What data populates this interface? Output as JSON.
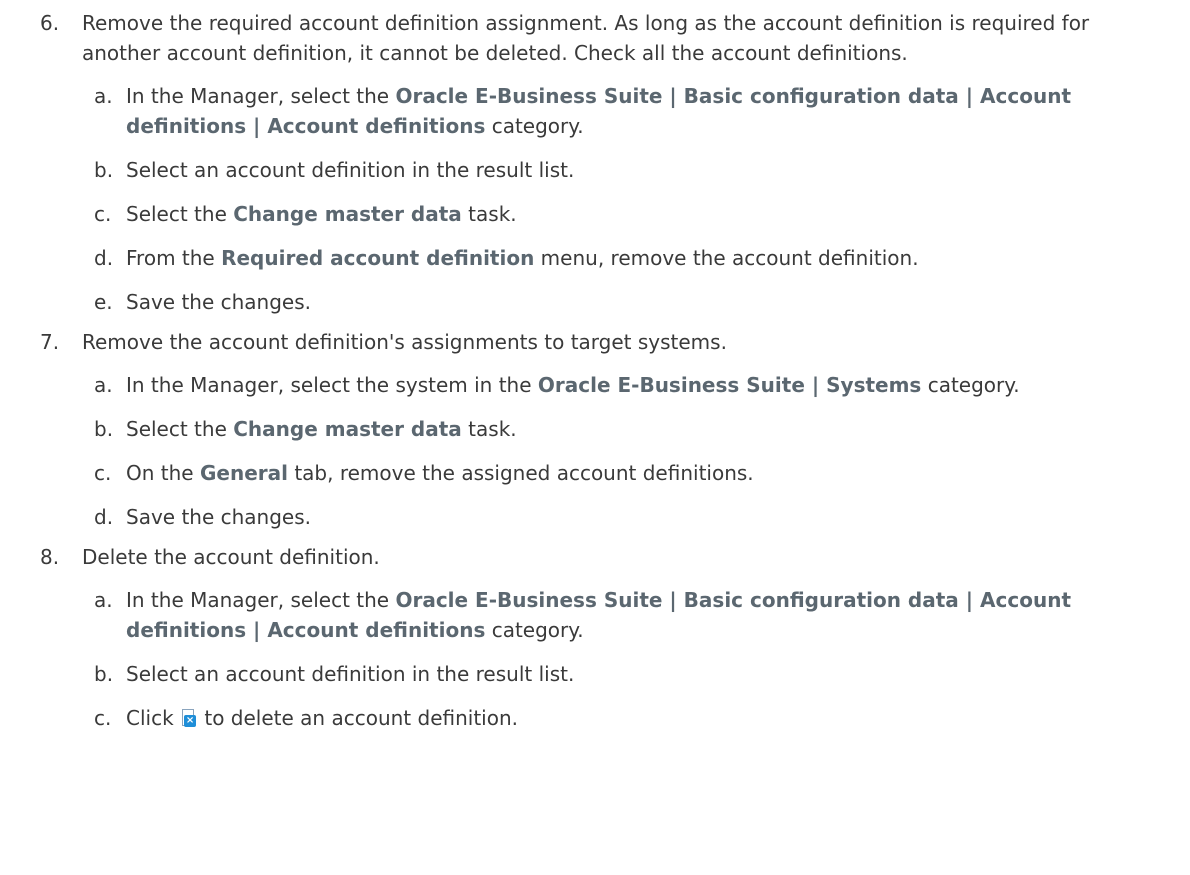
{
  "steps": [
    {
      "num": "6.",
      "parts": [
        {
          "t": "Remove the required account definition assignment. As long as the account definition is required for another account definition, it cannot be deleted. Check all the account definitions."
        }
      ],
      "substeps": [
        {
          "letter": "a.",
          "parts": [
            {
              "t": "In the Manager, select the "
            },
            {
              "t": "Oracle E-Business Suite | Basic configuration data | Account definitions | Account definitions",
              "b": true
            },
            {
              "t": " category."
            }
          ]
        },
        {
          "letter": "b.",
          "parts": [
            {
              "t": "Select an account definition in the result list."
            }
          ]
        },
        {
          "letter": "c.",
          "parts": [
            {
              "t": "Select the "
            },
            {
              "t": "Change master data",
              "b": true
            },
            {
              "t": " task."
            }
          ]
        },
        {
          "letter": "d.",
          "parts": [
            {
              "t": "From the "
            },
            {
              "t": "Required account definition",
              "b": true
            },
            {
              "t": " menu, remove the account definition."
            }
          ]
        },
        {
          "letter": "e.",
          "parts": [
            {
              "t": "Save the changes."
            }
          ]
        }
      ]
    },
    {
      "num": "7.",
      "parts": [
        {
          "t": "Remove the account definition's assignments to target systems."
        }
      ],
      "substeps": [
        {
          "letter": "a.",
          "parts": [
            {
              "t": "In the Manager, select the system in the "
            },
            {
              "t": "Oracle E-Business Suite | Systems",
              "b": true
            },
            {
              "t": " category."
            }
          ]
        },
        {
          "letter": "b.",
          "parts": [
            {
              "t": "Select the "
            },
            {
              "t": "Change master data",
              "b": true
            },
            {
              "t": " task."
            }
          ]
        },
        {
          "letter": "c.",
          "parts": [
            {
              "t": "On the "
            },
            {
              "t": "General",
              "b": true
            },
            {
              "t": " tab, remove the assigned account definitions."
            }
          ]
        },
        {
          "letter": "d.",
          "parts": [
            {
              "t": "Save the changes."
            }
          ]
        }
      ]
    },
    {
      "num": "8.",
      "parts": [
        {
          "t": "Delete the account definition."
        }
      ],
      "substeps": [
        {
          "letter": "a.",
          "parts": [
            {
              "t": "In the Manager, select the "
            },
            {
              "t": "Oracle E-Business Suite | Basic configuration data | Account definitions | Account definitions",
              "b": true
            },
            {
              "t": " category."
            }
          ]
        },
        {
          "letter": "b.",
          "parts": [
            {
              "t": "Select an account definition in the result list."
            }
          ]
        },
        {
          "letter": "c.",
          "parts": [
            {
              "t": "Click "
            },
            {
              "icon": "delete-account-definition-icon"
            },
            {
              "t": " to delete an account definition."
            }
          ]
        }
      ]
    }
  ]
}
